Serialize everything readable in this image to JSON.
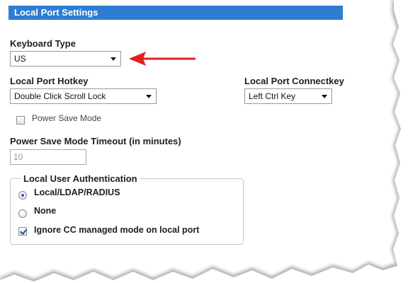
{
  "header": {
    "title": "Local Port Settings"
  },
  "keyboard": {
    "label": "Keyboard Type",
    "value": "US"
  },
  "hotkey": {
    "label": "Local Port Hotkey",
    "value": "Double Click Scroll Lock"
  },
  "connectkey": {
    "label": "Local Port Connectkey",
    "value": "Left Ctrl Key"
  },
  "power_save": {
    "label": "Power Save Mode",
    "checked": false
  },
  "timeout": {
    "label": "Power Save Mode Timeout (in minutes)",
    "value": "10"
  },
  "auth": {
    "legend": "Local User Authentication",
    "options": [
      {
        "label": "Local/LDAP/RADIUS",
        "checked": true
      },
      {
        "label": "None",
        "checked": false
      }
    ],
    "ignore_cc": {
      "label": "Ignore CC managed mode on local port",
      "checked": true
    }
  },
  "colors": {
    "header_bg": "#2d7dd2",
    "arrow": "#e02020"
  },
  "icons": {
    "annotation": "red-arrow-icon",
    "dropdown": "chevron-down-icon"
  }
}
